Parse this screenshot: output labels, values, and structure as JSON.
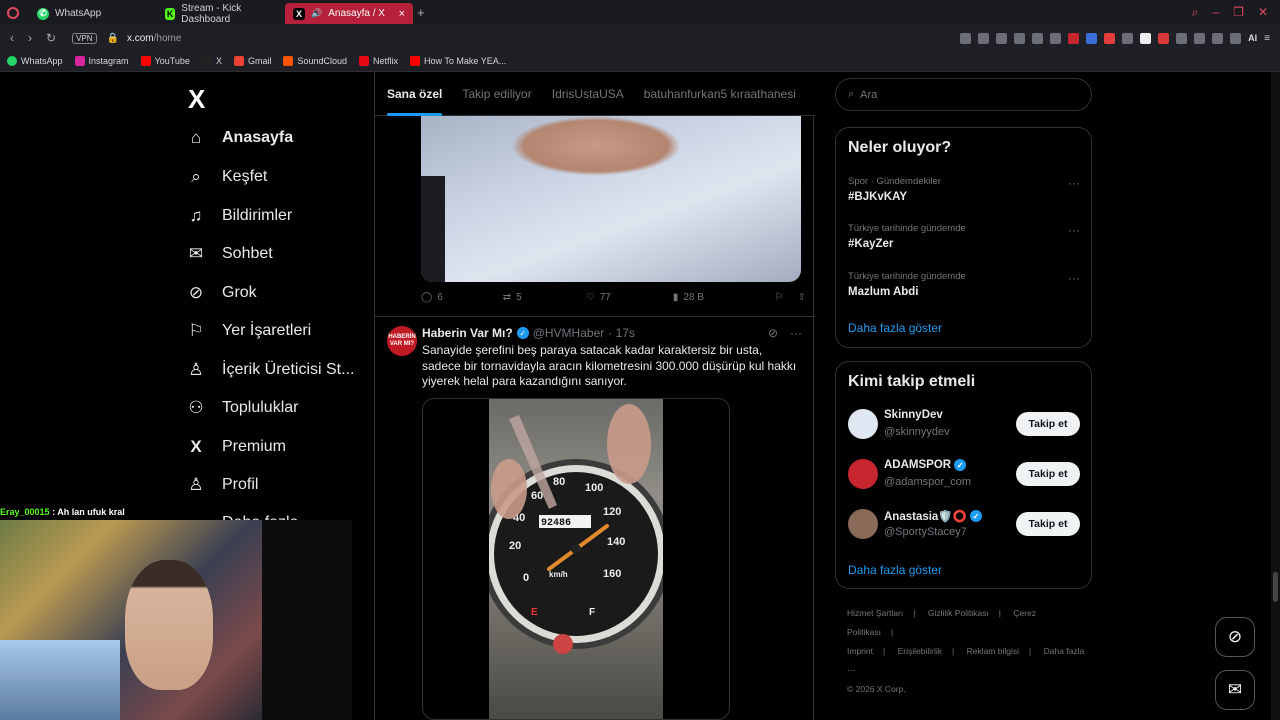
{
  "browser": {
    "tabs": [
      {
        "label": "WhatsApp",
        "icon": "whatsapp-icon",
        "color": "#25d366"
      },
      {
        "label": "Stream - Kick Dashboard",
        "icon": "kick-icon",
        "color": "#53fc18"
      },
      {
        "label": "Anasayfa / X",
        "icon": "x-icon",
        "color": "#000000"
      }
    ],
    "new_tab": "+",
    "vpn": "VPN",
    "url_host": "x.com",
    "url_path": "/home",
    "ai_label": "AI",
    "bookmarks": [
      {
        "label": "WhatsApp",
        "color": "#25d366"
      },
      {
        "label": "Instagram",
        "color": "#d6249f"
      },
      {
        "label": "YouTube",
        "color": "#ff0000"
      },
      {
        "label": "X",
        "color": "#222222"
      },
      {
        "label": "Gmail",
        "color": "#ea4335"
      },
      {
        "label": "SoundCloud",
        "color": "#ff5500"
      },
      {
        "label": "Netflix",
        "color": "#e50914"
      },
      {
        "label": "How To Make YEA...",
        "color": "#ff0000"
      }
    ]
  },
  "nav": {
    "logo": "X",
    "items": [
      {
        "label": "Anasayfa",
        "icon": "home-icon"
      },
      {
        "label": "Keşfet",
        "icon": "search-icon"
      },
      {
        "label": "Bildirimler",
        "icon": "bell-icon"
      },
      {
        "label": "Sohbet",
        "icon": "mail-icon"
      },
      {
        "label": "Grok",
        "icon": "grok-icon"
      },
      {
        "label": "Yer İşaretleri",
        "icon": "bookmark-icon"
      },
      {
        "label": "İçerik Üreticisi St...",
        "icon": "creator-icon"
      },
      {
        "label": "Topluluklar",
        "icon": "communities-icon"
      },
      {
        "label": "Premium",
        "icon": "x-premium-icon"
      },
      {
        "label": "Profil",
        "icon": "profile-icon"
      },
      {
        "label": "Daha fazla",
        "icon": "more-icon"
      }
    ]
  },
  "feed": {
    "tabs": [
      "Sana özel",
      "Takip ediliyor",
      "IdrisUstaUSA",
      "batuhanfurkan5 kıraathanesi"
    ],
    "post1_actions": {
      "replies": "6",
      "reposts": "5",
      "likes": "77",
      "views": "28 B"
    },
    "post2": {
      "avatar_text": "HABERİN VAR MI?",
      "name": "Haberin Var Mı?",
      "handle": "@HVMHaber",
      "time": "· 17s",
      "text": "Sanayide şerefini beş paraya satacak kadar karaktersiz bir usta, sadece bir tornavidayla aracın kilometresini 300.000 düşürüp kul hakkı yiyerek helal para kazandığını sanıyor.",
      "odometer": "92486",
      "speed_labels": [
        "0",
        "20",
        "40",
        "60",
        "80",
        "100",
        "120",
        "140",
        "160"
      ],
      "unit": "km/h",
      "fuel_e": "E",
      "fuel_f": "F"
    }
  },
  "right": {
    "search_placeholder": "Ara",
    "trends_title": "Neler oluyor?",
    "trends": [
      {
        "meta": "Spor · Gündemdekiler",
        "title": "#BJKvKAY"
      },
      {
        "meta": "Türkiye tarihinde gündemde",
        "title": "#KayZer"
      },
      {
        "meta": "Türkiye tarihinde gündemde",
        "title": "Mazlum Abdi"
      }
    ],
    "show_more": "Daha fazla göster",
    "follow_title": "Kimi takip etmeli",
    "follow": [
      {
        "name": "SkinnyDev",
        "handle": "@skinnyydev",
        "button": "Takip et",
        "verified": false,
        "avatar_color": "#dfe7f2"
      },
      {
        "name": "ADAMSPOR",
        "handle": "@adamspor_com",
        "button": "Takip et",
        "verified": true,
        "avatar_color": "#c8262f"
      },
      {
        "name": "Anastasia🛡️⭕",
        "handle": "@SportyStacey7",
        "button": "Takip et",
        "verified": true,
        "avatar_color": "#8a6a58"
      }
    ],
    "footer": [
      "Hizmet Şartları",
      "|",
      "Gizlilik Politikası",
      "|",
      "Çerez Politikası",
      "|",
      "Imprint",
      "|",
      "Erişilebilirlik",
      "|",
      "Reklam bilgisi",
      "|",
      "Daha fazla ···",
      "© 2026 X Corp."
    ]
  },
  "stream": {
    "chat_user": "Eray_00015",
    "chat_sep": " : ",
    "chat_message": "Ah lan ufuk kral"
  }
}
